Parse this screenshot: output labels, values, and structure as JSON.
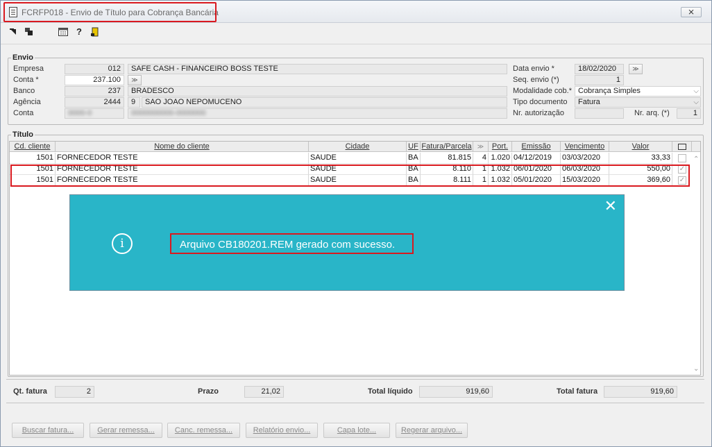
{
  "window": {
    "title": "FCRFP018 - Envio de Título para Cobrança Bancária",
    "close_label": "⨯"
  },
  "toolbar": {
    "icons": [
      "arrow-icon",
      "stack-icon",
      "calendar-icon",
      "help-icon",
      "exit-icon"
    ],
    "help_glyph": "?"
  },
  "envio": {
    "legend": "Envio",
    "empresa": {
      "label": "Empresa",
      "code": "012",
      "name": "SAFE CASH - FINANCEIRO BOSS TESTE"
    },
    "conta_star": {
      "label": "Conta *",
      "value": "237.100"
    },
    "banco": {
      "label": "Banco",
      "code": "237",
      "name": "BRADESCO"
    },
    "agencia": {
      "label": "Agência",
      "code": "2444",
      "digit": "9",
      "name": "SAO JOAO NEPOMUCENO"
    },
    "conta": {
      "label": "Conta",
      "value": "0000-0",
      "name": "0000000000-0000000"
    },
    "data_envio": {
      "label": "Data envio *",
      "value": "18/02/2020"
    },
    "seq_envio": {
      "label": "Seq. envio (*)",
      "value": "1"
    },
    "modalidade": {
      "label": "Modalidade cob.*",
      "value": "Cobrança Simples"
    },
    "tipo_documento": {
      "label": "Tipo documento",
      "value": "Fatura"
    },
    "nr_autorizacao": {
      "label": "Nr. autorização",
      "value": ""
    },
    "nr_arq": {
      "label": "Nr. arq. (*)",
      "value": "1"
    }
  },
  "titulo": {
    "legend": "Título",
    "columns": [
      "Cd. cliente",
      "Nome do cliente",
      "Cidade",
      "UF",
      "Fatura/Parcela",
      "",
      "Port.",
      "Emissão",
      "Vencimento",
      "Valor"
    ],
    "rows": [
      {
        "cd": "1501",
        "nome": "FORNECEDOR TESTE",
        "cidade": "SAUDE",
        "uf": "BA",
        "fatura": "81.815",
        "parcela": "4",
        "port": "1.020",
        "emissao": "04/12/2019",
        "vencimento": "03/03/2020",
        "valor": "33,33",
        "checked": false
      },
      {
        "cd": "1501",
        "nome": "FORNECEDOR TESTE",
        "cidade": "SAUDE",
        "uf": "BA",
        "fatura": "8.110",
        "parcela": "1",
        "port": "1.032",
        "emissao": "06/01/2020",
        "vencimento": "06/03/2020",
        "valor": "550,00",
        "checked": true
      },
      {
        "cd": "1501",
        "nome": "FORNECEDOR TESTE",
        "cidade": "SAUDE",
        "uf": "BA",
        "fatura": "8.111",
        "parcela": "1",
        "port": "1.032",
        "emissao": "05/01/2020",
        "vencimento": "15/03/2020",
        "valor": "369,60",
        "checked": true
      }
    ]
  },
  "dialog": {
    "message": "Arquivo CB180201.REM gerado com sucesso.",
    "close_label": "✕",
    "info_glyph": "i"
  },
  "totals": {
    "qt_fatura": {
      "label": "Qt. fatura",
      "value": "2"
    },
    "prazo": {
      "label": "Prazo",
      "value": "21,02"
    },
    "total_liquido": {
      "label": "Total líquido",
      "value": "919,60"
    },
    "total_fatura": {
      "label": "Total fatura",
      "value": "919,60"
    }
  },
  "buttons": {
    "buscar": "Buscar fatura...",
    "gerar": "Gerar remessa...",
    "canc": "Canc. remessa...",
    "relatorio": "Relatório envio...",
    "capa": "Capa lote...",
    "regerar": "Regerar arquivo..."
  },
  "colors": {
    "dialog_bg": "#29b5c8",
    "highlight": "#d9191f"
  }
}
